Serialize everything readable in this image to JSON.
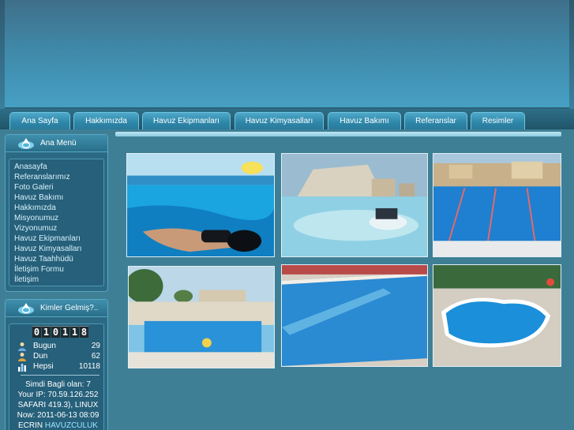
{
  "nav": {
    "items": [
      {
        "label": "Ana Sayfa"
      },
      {
        "label": "Hakkımızda"
      },
      {
        "label": "Havuz Ekipmanları"
      },
      {
        "label": "Havuz Kimyasalları"
      },
      {
        "label": "Havuz Bakımı"
      },
      {
        "label": "Referanslar"
      },
      {
        "label": "Resimler"
      }
    ]
  },
  "sidebar": {
    "menu_title": "Ana Menü",
    "menu_items": [
      {
        "label": "Anasayfa"
      },
      {
        "label": "Referanslarımız"
      },
      {
        "label": "Foto Galeri"
      },
      {
        "label": "Havuz Bakımı"
      },
      {
        "label": "Hakkımızda"
      },
      {
        "label": "Misyonumuz"
      },
      {
        "label": "Vizyonumuz"
      },
      {
        "label": "Havuz Ekipmanları"
      },
      {
        "label": "Havuz Kimyasalları"
      },
      {
        "label": "Havuz Taahhüdü"
      },
      {
        "label": "İletişim Formu"
      },
      {
        "label": "İletişim"
      }
    ],
    "visitors_title": "Kimler Gelmiş?..",
    "counter_digits": [
      "0",
      "1",
      "0",
      "1",
      "1",
      "8"
    ],
    "stats": [
      {
        "label": "Bugun",
        "value": "29"
      },
      {
        "label": "Dun",
        "value": "62"
      },
      {
        "label": "Hepsi",
        "value": "10118"
      }
    ],
    "online_line": "Simdi Bagli olan: 7",
    "ip_line": "Your IP: 70.59.126.252",
    "browser_line": "SAFARI 419.3), LINUX",
    "now_line": "Now: 2011-06-13 08:09",
    "footer_prefix": "ECRIN",
    "footer_highlight": "HAVUZCULUK"
  },
  "colors": {
    "accent": "#3f88a8",
    "link": "#d8f1fb",
    "highlight": "#9fe4ff"
  }
}
